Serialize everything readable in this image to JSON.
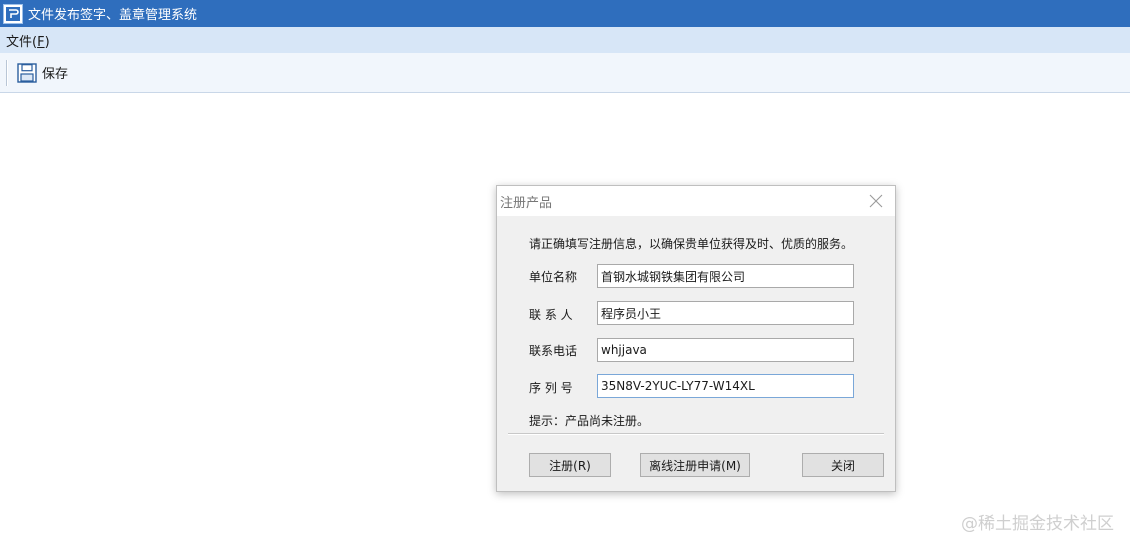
{
  "window": {
    "title": "文件发布签字、盖章管理系统"
  },
  "menu": {
    "file_label": "文件(",
    "file_key": "F",
    "file_suffix": ")"
  },
  "toolbar": {
    "save_label": "保存",
    "save_icon": "floppy-disk-icon"
  },
  "dialog": {
    "title": "注册产品",
    "intro": "请正确填写注册信息，以确保贵单位获得及时、优质的服务。",
    "fields": [
      {
        "label": "单位名称",
        "value": "首钢水城钢铁集团有限公司"
      },
      {
        "label": "联 系 人",
        "value": "程序员小王"
      },
      {
        "label": "联系电话",
        "value": "whjjava"
      },
      {
        "label": "序 列 号",
        "value": "35N8V-2YUC-LY77-W14XL"
      }
    ],
    "hint": "提示：产品尚未注册。",
    "buttons": {
      "register": "注册(R)",
      "offline": "离线注册申请(M)",
      "close": "关闭"
    }
  },
  "watermark": "@稀土掘金技术社区",
  "colors": {
    "titlebar": "#2f6ebd",
    "menubar": "#d7e6f7",
    "toolbar": "#f1f6fc",
    "dialog_body": "#f0f0f0"
  }
}
